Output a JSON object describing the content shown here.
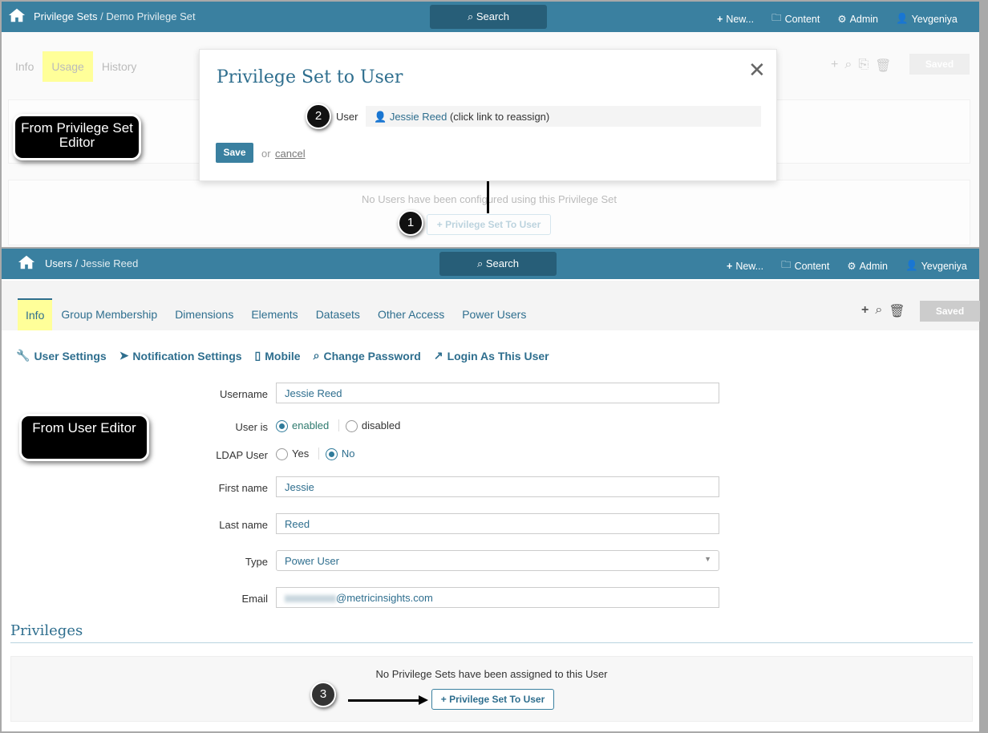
{
  "top": {
    "breadcrumb_parent": "Privilege Sets",
    "breadcrumb_sep": " / ",
    "breadcrumb_current": "Demo Privilege Set",
    "search": "Search",
    "nav": {
      "new": "New...",
      "content": "Content",
      "admin": "Admin",
      "user": "Yevgeniya"
    },
    "tabs": [
      "Info",
      "Usage",
      "History"
    ],
    "saved": "Saved",
    "empty_text": "No Users have been configured using this Privilege Set",
    "add_button": "Privilege Set To User",
    "callout": "From Privilege Set Editor",
    "step": "1"
  },
  "modal": {
    "title": "Privilege Set to User",
    "user_label": "User",
    "user_link": "Jessie Reed",
    "user_hint": " (click link to reassign)",
    "save": "Save",
    "or": "or",
    "cancel": "cancel",
    "step": "2"
  },
  "bottom": {
    "breadcrumb_parent": "Users",
    "breadcrumb_sep": " / ",
    "breadcrumb_current": "Jessie Reed",
    "search": "Search",
    "nav": {
      "new": "New...",
      "content": "Content",
      "admin": "Admin",
      "user": "Yevgeniya"
    },
    "tabs": [
      "Info",
      "Group Membership",
      "Dimensions",
      "Elements",
      "Datasets",
      "Other Access",
      "Power Users"
    ],
    "saved": "Saved",
    "actions": [
      "User Settings",
      "Notification Settings",
      "Mobile",
      "Change Password",
      "Login As This User"
    ],
    "callout": "From User Editor",
    "form": {
      "username_label": "Username",
      "username": "Jessie Reed",
      "status_label": "User is",
      "enabled": "enabled",
      "disabled": "disabled",
      "ldap_label": "LDAP User",
      "yes": "Yes",
      "no": "No",
      "first_label": "First name",
      "first": "Jessie",
      "last_label": "Last name",
      "last": "Reed",
      "type_label": "Type",
      "type": "Power User",
      "email_label": "Email",
      "email_domain": "@metricinsights.com"
    },
    "privileges_title": "Privileges",
    "empty_text": "No Privilege Sets have been assigned to this User",
    "add_button": "Privilege Set To User",
    "step": "3"
  },
  "colors": {
    "header": "#3a80a0",
    "accent": "#2e6e8e",
    "highlight": "#ffff99"
  }
}
